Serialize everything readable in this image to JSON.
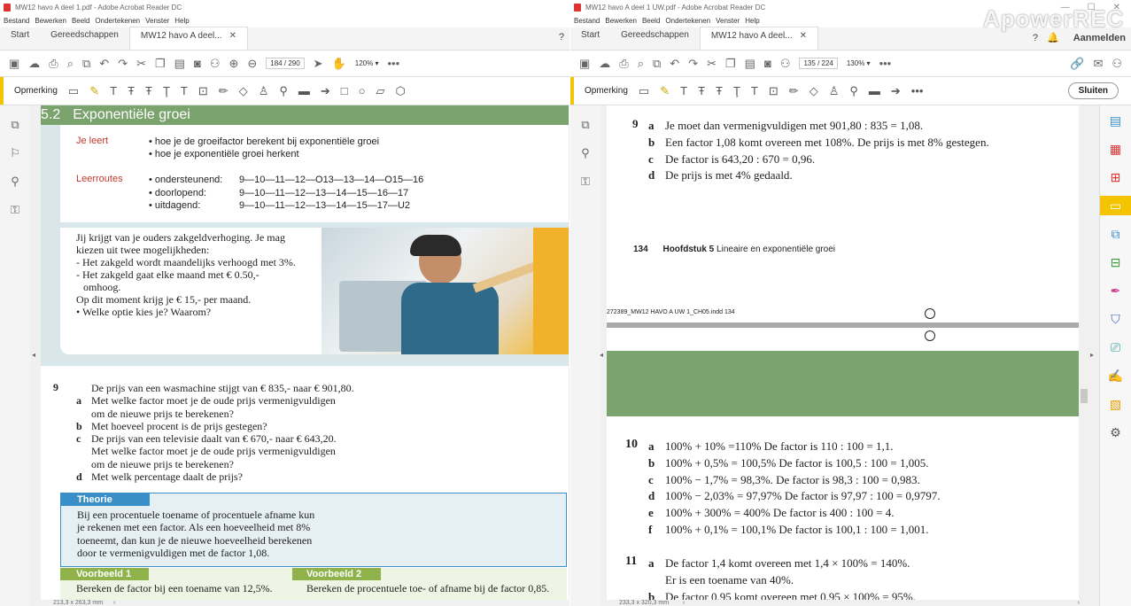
{
  "left": {
    "window_title": "MW12 havo A deel 1.pdf - Adobe Acrobat Reader DC",
    "menu": [
      "Bestand",
      "Bewerken",
      "Beeld",
      "Ondertekenen",
      "Venster",
      "Help"
    ],
    "tabs": {
      "start": "Start",
      "tools": "Gereedschappen",
      "doc": "MW12 havo A deel..."
    },
    "page_current": "184",
    "page_total": "/ 290",
    "zoom": "120%",
    "comment_label": "Opmerking",
    "section_number": "5.2",
    "section_title": "Exponentiële groei",
    "je_leert_label": "Je leert",
    "je_leert": [
      "• hoe je de groeifactor berekent bij exponentiële groei",
      "• hoe je exponentiële groei herkent"
    ],
    "leerroutes_label": "Leerroutes",
    "routes": [
      {
        "name": "• ondersteunend:",
        "path": "9—10—11—12—O13—13—14—O15—16"
      },
      {
        "name": "• doorlopend:",
        "path": "9—10—11—12—13—14—15—16—17"
      },
      {
        "name": "• uitdagend:",
        "path": "9—10—11—12—13—14—15—17—U2"
      }
    ],
    "intro": [
      "Jij krijgt van je ouders zakgeldverhoging. Je mag",
      "kiezen uit twee mogelijkheden:",
      "- Het zakgeld wordt maandelijks verhoogd met 3%.",
      "- Het zakgeld gaat elke maand met € 0.50,-",
      "  omhoog.",
      "Op dit moment krijg je € 15,- per maand.",
      "• Welke optie kies je? Waarom?"
    ],
    "q9_number": "9",
    "q9_lines": [
      {
        "l": "",
        "t": "De prijs van een wasmachine stijgt van € 835,- naar € 901,80."
      },
      {
        "l": "a",
        "t": "Met welke factor moet je de oude prijs vermenigvuldigen"
      },
      {
        "l": "",
        "t": "om de nieuwe prijs te berekenen?"
      },
      {
        "l": "b",
        "t": "Met hoeveel procent is de prijs gestegen?"
      },
      {
        "l": "c",
        "t": "De prijs van een televisie daalt van € 670,- naar € 643,20."
      },
      {
        "l": "",
        "t": "Met welke factor moet je de oude prijs vermenigvuldigen"
      },
      {
        "l": "",
        "t": "om de nieuwe prijs te berekenen?"
      },
      {
        "l": "d",
        "t": "Met welk percentage daalt de prijs?"
      }
    ],
    "theorie_label": "Theorie",
    "theorie_lines": [
      "Bij een procentuele toename of procentuele afname kun",
      "je rekenen met een factor. Als een hoeveelheid met 8%",
      "toeneemt, dan kun je de nieuwe hoeveelheid berekenen",
      "door te vermenigvuldigen met de factor 1,08."
    ],
    "vb1_label": "Voorbeeld 1",
    "vb1_text": "Bereken de factor bij een toename van 12,5%.",
    "vb2_label": "Voorbeeld 2",
    "vb2_text": "Bereken de procentuele toe- of afname bij de factor 0,85.",
    "page_size": "213,3 x 263,3 mm"
  },
  "right": {
    "window_title": "MW12 havo A deel 1 UW.pdf - Adobe Acrobat Reader DC",
    "menu": [
      "Bestand",
      "Bewerken",
      "Beeld",
      "Ondertekenen",
      "Venster",
      "Help"
    ],
    "tabs": {
      "start": "Start",
      "tools": "Gereedschappen",
      "doc": "MW12 havo A deel..."
    },
    "signin": "Aanmelden",
    "page_current": "135",
    "page_total": "/ 224",
    "zoom": "130%",
    "comment_label": "Opmerking",
    "close_label": "Sluiten",
    "a9_number": "9",
    "a9": [
      {
        "l": "a",
        "t": "Je moet dan vermenigvuldigen met 901,80 : 835 = 1,08."
      },
      {
        "l": "b",
        "t": "Een factor 1,08 komt overeen met 108%. De prijs is met 8% gestegen."
      },
      {
        "l": "c",
        "t": "De factor is 643,20 : 670 = 0,96."
      },
      {
        "l": "d",
        "t": "De prijs is met 4% gedaald."
      }
    ],
    "footer_page": "134",
    "footer_chapter": "Hoofdstuk 5",
    "footer_title": "Lineaire en exponentiële groei",
    "indd": "272389_MW12 HAVO A UW 1_CH05.indd   134",
    "a10_number": "10",
    "a10": [
      {
        "l": "a",
        "t": "100% + 10% =110% De factor is 110 : 100 = 1,1."
      },
      {
        "l": "b",
        "t": "100% + 0,5% = 100,5% De factor is 100,5 : 100 = 1,005."
      },
      {
        "l": "c",
        "t": "100% − 1,7% = 98,3%. De factor is 98,3 : 100 = 0,983."
      },
      {
        "l": "d",
        "t": "100% − 2,03% = 97,97% De factor is 97,97 : 100 = 0,9797."
      },
      {
        "l": "e",
        "t": "100% + 300% = 400% De factor is 400 : 100 = 4."
      },
      {
        "l": "f",
        "t": "100% + 0,1% = 100,1% De factor is 100,1 : 100 = 1,001."
      }
    ],
    "a11_number": "11",
    "a11": [
      {
        "l": "a",
        "t": "De factor 1,4 komt overeen met 1,4 × 100% = 140%."
      },
      {
        "l": "",
        "t": "Er is een toename van 40%."
      },
      {
        "l": "b",
        "t": "De factor 0,95 komt overeen met 0,95 × 100% = 95%."
      }
    ],
    "page_size": "233,3 x 320,3 mm"
  },
  "watermark": "ApowerREC",
  "colors": {
    "green": "#7ba36e",
    "red": "#c0392b",
    "blue": "#3a8fc9",
    "yellow": "#f5c400",
    "theorie_bg": "#e6eff3",
    "vb_green": "#8fb34a"
  }
}
